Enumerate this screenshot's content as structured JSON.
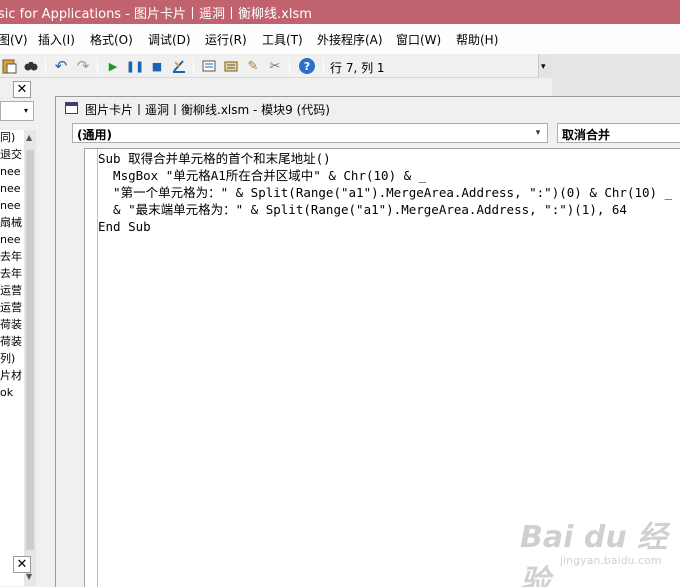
{
  "window": {
    "title": "sic for Applications - 图片卡片丨遥洞丨衡柳线.xlsm"
  },
  "menu": [
    "图(V)",
    "插入(I)",
    "格式(O)",
    "调试(D)",
    "运行(R)",
    "工具(T)",
    "外接程序(A)",
    "窗口(W)",
    "帮助(H)"
  ],
  "toolbar": {
    "icons": [
      "paste-icon",
      "find-icon",
      "undo-icon",
      "redo-icon",
      "run-icon",
      "break-icon",
      "reset-icon",
      "design-mode-icon",
      "project-explorer-icon",
      "properties-icon",
      "object-browser-icon",
      "toolbox-icon",
      "help-icon"
    ],
    "position_label": "行 7, 列 1"
  },
  "project_panel": {
    "items": [
      "同)",
      "退交",
      "nee",
      "nee",
      "nee",
      "扇械",
      "nee",
      "去年",
      "去年",
      "运营",
      "运营",
      "荷装",
      "荷装",
      "列)",
      "片材",
      "ok"
    ]
  },
  "code_window": {
    "title": "图片卡片丨遥洞丨衡柳线.xlsm - 模块9 (代码)",
    "object_combo": "(通用)",
    "procedure_combo": "取消合并",
    "code_lines": [
      "Sub 取得合并单元格的首个和末尾地址()",
      "  MsgBox \"单元格A1所在合并区域中\" & Chr(10) & _",
      "  \"第一个单元格为：\" & Split(Range(\"a1\").MergeArea.Address, \":\")(0) & Chr(10) _",
      "  & \"最末端单元格为：\" & Split(Range(\"a1\").MergeArea.Address, \":\")(1), 64",
      "End Sub"
    ]
  },
  "watermark": {
    "brand": "Bai du 经验",
    "site": "jingyan.baidu.com"
  },
  "colors": {
    "titlebar": "#c0636e",
    "accent_blue": "#1a63b5",
    "run_green": "#1a9a1a"
  }
}
